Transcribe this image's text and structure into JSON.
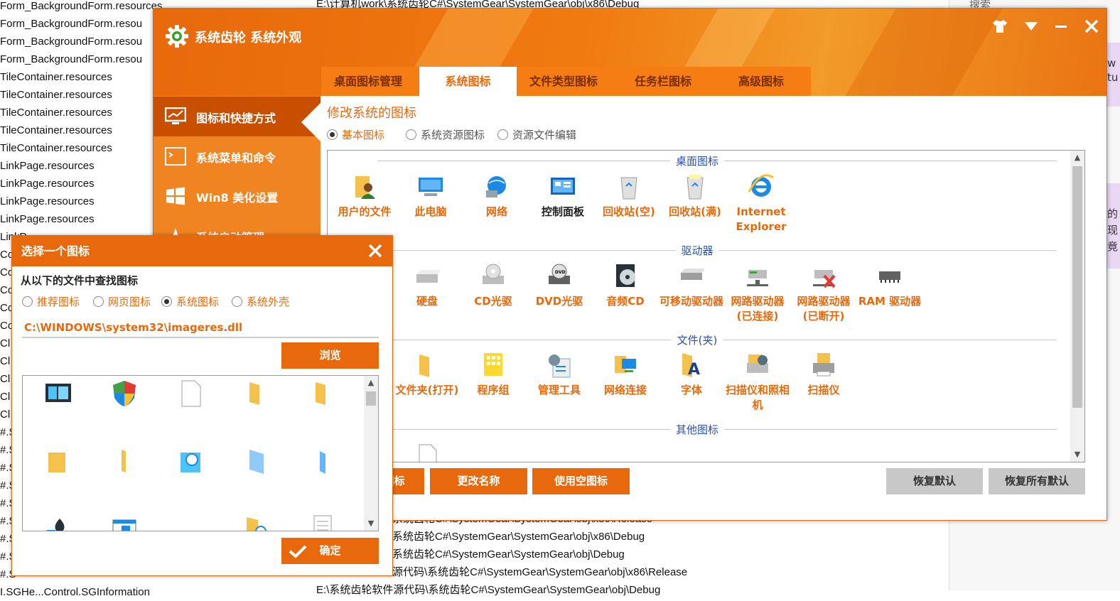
{
  "background": {
    "left_lines": [
      "Form_BackgroundForm.resources",
      "Form_BackgroundForm.resou",
      "Form_BackgroundForm.resou",
      "Form_BackgroundForm.resou",
      "TileContainer.resources",
      "TileContainer.resources",
      "TileContainer.resources",
      "TileContainer.resources",
      "TileContainer.resources",
      "LinkPage.resources",
      "LinkPage.resources",
      "LinkPage.resources",
      "LinkPage.resources",
      "LinkP",
      "Co",
      "Co",
      "Co",
      "Co",
      "Co",
      "Cl",
      "Cl",
      "Cl",
      "Cl",
      "Cl",
      "#.S",
      "#.S",
      "#.S",
      "#.S",
      "#.S",
      "#.S",
      "#.S",
      "#.S",
      "#.S",
      "I.SGHe...Control.SGInformation"
    ],
    "top_path": "E:\\计算机work\\系统齿轮C#\\SystemGear\\SystemGear\\obj\\x86\\Debug",
    "bottom_lines": [
      "系统齿轮C#\\SystemGear\\SystemGear\\obj\\x86\\Release",
      "系统齿轮C#\\SystemGear\\SystemGear\\obj\\x86\\Debug",
      "系统齿轮C#\\SystemGear\\SystemGear\\obj\\Debug",
      "源代码\\系统齿轮C#\\SystemGear\\SystemGear\\obj\\x86\\Release",
      "E:\\系统齿轮软件源代码\\系统齿轮C#\\SystemGear\\SystemGear\\obj\\Debug"
    ],
    "right_search": "搜索",
    "right_fragments": [
      "w",
      "tu",
      "的",
      "现",
      "竟"
    ]
  },
  "app": {
    "title": "系统齿轮 系统外观",
    "accent": "#e8690b",
    "window_controls": [
      "shirt-icon",
      "dropdown-icon",
      "minimize-icon",
      "close-icon"
    ],
    "tabs": [
      {
        "label": "桌面图标管理",
        "active": false
      },
      {
        "label": "系统图标",
        "active": true
      },
      {
        "label": "文件类型图标",
        "active": false
      },
      {
        "label": "任务栏图标",
        "active": false
      },
      {
        "label": "高级图标",
        "active": false
      }
    ],
    "sidebar": [
      {
        "label": "图标和快捷方式",
        "icon": "monitor-icon",
        "active": true
      },
      {
        "label": "系统菜单和命令",
        "icon": "terminal-icon",
        "active": false
      },
      {
        "label": "Win8 美化设置",
        "icon": "windows-logo-icon",
        "active": false
      },
      {
        "label": "系统启动管理",
        "icon": "startup-icon",
        "active": false
      }
    ],
    "section_title": "修改系统的图标",
    "modes": [
      {
        "label": "基本图标",
        "checked": true
      },
      {
        "label": "系统资源图标",
        "checked": false
      },
      {
        "label": "资源文件编辑",
        "checked": false
      }
    ],
    "groups": [
      {
        "title": "桌面图标",
        "items": [
          {
            "label": "用户的文件",
            "icon": "user-folder-icon"
          },
          {
            "label": "此电脑",
            "icon": "computer-icon"
          },
          {
            "label": "网络",
            "icon": "network-icon"
          },
          {
            "label": "控制面板",
            "icon": "control-panel-icon",
            "selected": true
          },
          {
            "label": "回收站(空)",
            "icon": "recycle-bin-empty-icon"
          },
          {
            "label": "回收站(满)",
            "icon": "recycle-bin-full-icon"
          },
          {
            "label": "Internet Explorer",
            "icon": "internet-explorer-icon"
          }
        ]
      },
      {
        "title": "驱动器",
        "items": [
          {
            "label": "硬盘",
            "icon": "hard-disk-icon"
          },
          {
            "label": "CD光驱",
            "icon": "cd-drive-icon"
          },
          {
            "label": "DVD光驱",
            "icon": "dvd-drive-icon"
          },
          {
            "label": "音频CD",
            "icon": "audio-cd-icon"
          },
          {
            "label": "可移动驱动器",
            "icon": "removable-drive-icon"
          },
          {
            "label": "网路驱动器(已连接)",
            "icon": "network-drive-connected-icon"
          },
          {
            "label": "网路驱动器(已断开)",
            "icon": "network-drive-disconnected-icon"
          },
          {
            "label": "RAM 驱动器",
            "icon": "ram-drive-icon"
          }
        ]
      },
      {
        "title": "文件(夹)",
        "items": [
          {
            "label": "文件夹(打开)",
            "icon": "folder-open-icon"
          },
          {
            "label": "程序组",
            "icon": "program-group-icon"
          },
          {
            "label": "管理工具",
            "icon": "admin-tools-icon"
          },
          {
            "label": "网络连接",
            "icon": "network-connections-icon"
          },
          {
            "label": "字体",
            "icon": "fonts-folder-icon"
          },
          {
            "label": "扫描仪和照相机",
            "icon": "scanner-camera-icon"
          },
          {
            "label": "扫描仪",
            "icon": "printer-icon"
          }
        ]
      },
      {
        "title": "其他图标",
        "items": [
          {
            "label": "",
            "icon": "blank-document-icon"
          }
        ]
      }
    ],
    "buttons": {
      "rename": "更改名称",
      "use_empty": "使用空图标",
      "restore_default": "恢复默认",
      "restore_all": "恢复所有默认",
      "hidden_left": "更改图标"
    }
  },
  "dialog": {
    "title": "选择一个图标",
    "prompt": "从以下的文件中查找图标",
    "sources": [
      {
        "label": "推荐图标",
        "checked": false
      },
      {
        "label": "网页图标",
        "checked": false
      },
      {
        "label": "系统图标",
        "checked": true
      },
      {
        "label": "系统外壳",
        "checked": false
      }
    ],
    "path": "C:\\WINDOWS\\system32\\imageres.dll",
    "browse": "浏览",
    "ok": "确定",
    "icons": [
      "slideshow-icon",
      "uac-shield-icon",
      "blank-page-icon",
      "folder-icon",
      "folder-icon",
      "folder-closed-icon",
      "folder-thin-icon",
      "search-globe-icon",
      "blue-folder-icon",
      "blue-folder-thin-icon",
      "spade-icon",
      "window-icon",
      "",
      "search-folder-icon",
      "list-document-icon"
    ]
  }
}
